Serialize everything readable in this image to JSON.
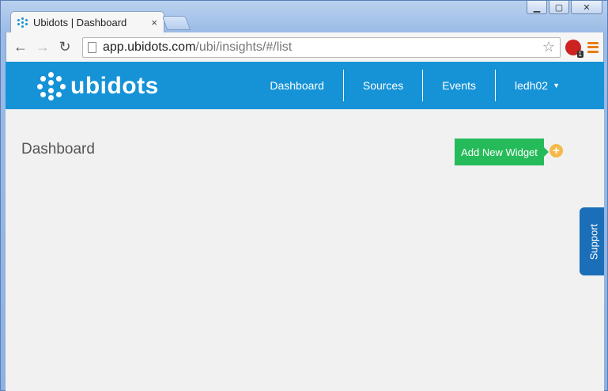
{
  "browser": {
    "tab_title": "Ubidots | Dashboard",
    "tab_close": "×",
    "url_host": "app.ubidots.com",
    "url_path": "/ubi/insights/#/list",
    "extension_badge": "1",
    "controls": {
      "minimize": "▁",
      "restore": "▢",
      "close": "✕"
    }
  },
  "navbar": {
    "logo_text": "ubidots",
    "items": [
      {
        "label": "Dashboard"
      },
      {
        "label": "Sources"
      },
      {
        "label": "Events"
      },
      {
        "label": "ledh02"
      }
    ],
    "caret": "▼"
  },
  "main": {
    "title": "Dashboard",
    "add_widget_label": "Add New Widget",
    "plus": "+"
  },
  "support": {
    "label": "Support"
  },
  "colors": {
    "navbar": "#1693d6",
    "add_button": "#26bb5a",
    "plus_badge": "#f5b94a",
    "support": "#1a6fb8"
  }
}
